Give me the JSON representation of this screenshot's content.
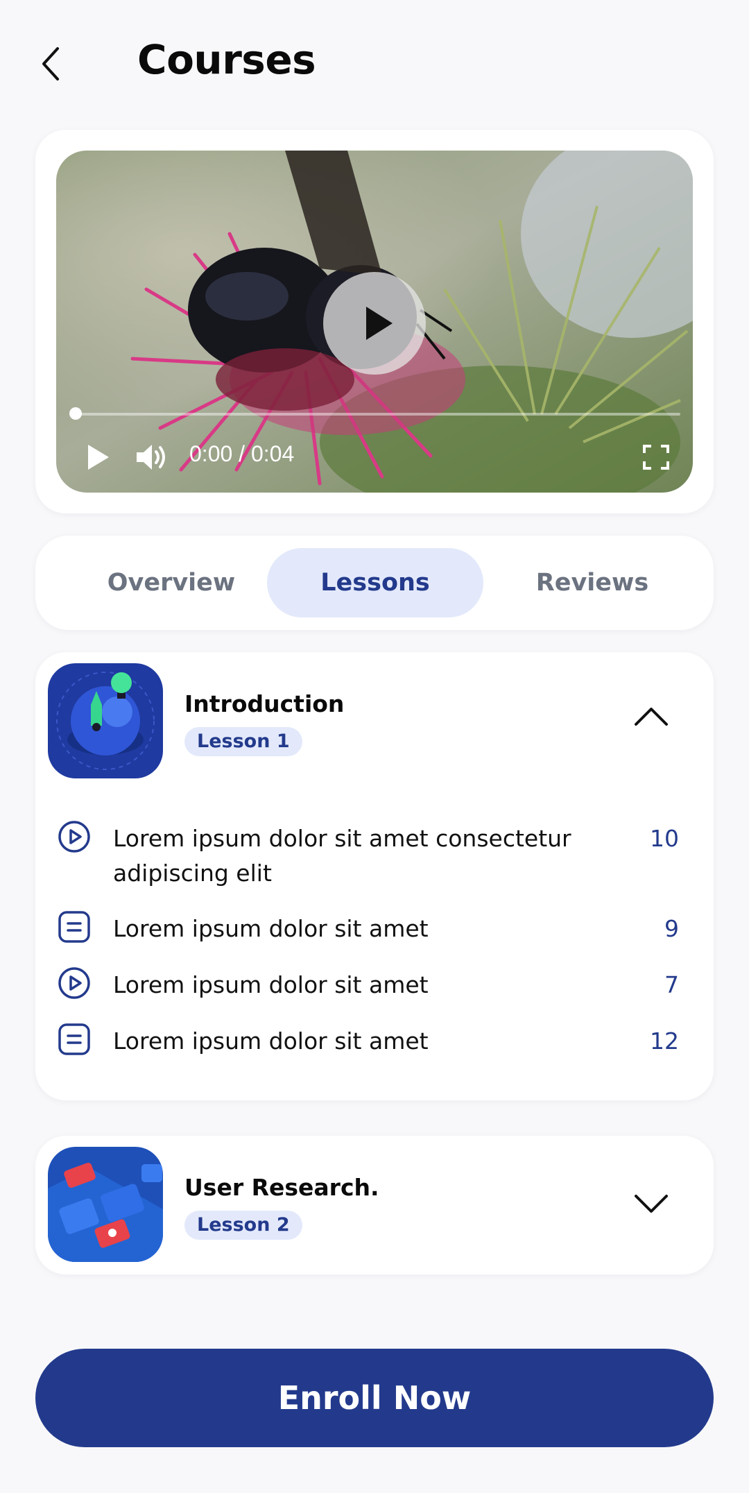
{
  "header": {
    "title": "Courses",
    "back_icon": "chevron-left-icon"
  },
  "video": {
    "time": "0:00 / 0:04",
    "progress": 0.0,
    "controls": [
      "play-icon",
      "volume-icon",
      "fullscreen-icon"
    ]
  },
  "tabs": [
    {
      "label": "Overview",
      "active": false
    },
    {
      "label": "Lessons",
      "active": true
    },
    {
      "label": "Reviews",
      "active": false
    }
  ],
  "sections": [
    {
      "title": "Introduction",
      "badge": "Lesson 1",
      "expanded": true,
      "lessons": [
        {
          "icon": "play-circle-icon",
          "title": "Lorem ipsum dolor sit amet consectetur adipiscing elit",
          "count": "10"
        },
        {
          "icon": "document-icon",
          "title": "Lorem ipsum dolor sit amet",
          "count": "9"
        },
        {
          "icon": "play-circle-icon",
          "title": "Lorem ipsum dolor sit amet",
          "count": "7"
        },
        {
          "icon": "document-icon",
          "title": "Lorem ipsum dolor sit amet",
          "count": "12"
        }
      ]
    },
    {
      "title": "User Research.",
      "badge": "Lesson 2",
      "expanded": false
    }
  ],
  "cta": {
    "label": "Enroll Now"
  },
  "colors": {
    "primary": "#233a8c",
    "accent_bg": "#e3e9fb",
    "muted": "#6b7280"
  }
}
